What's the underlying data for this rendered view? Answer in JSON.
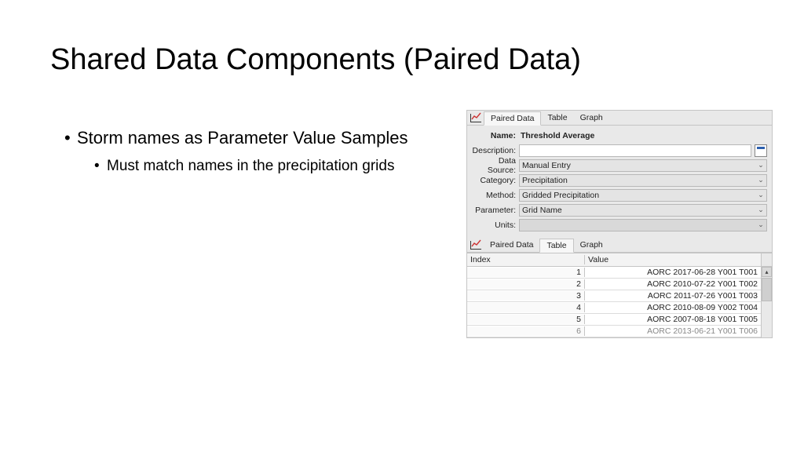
{
  "title": "Shared Data Components (Paired Data)",
  "bullets": {
    "l1": "Storm names as Parameter Value Samples",
    "l2": "Must match names in the precipitation grids"
  },
  "panel": {
    "tabs_upper": {
      "paired": "Paired Data",
      "table": "Table",
      "graph": "Graph"
    },
    "tabs_lower": {
      "paired": "Paired Data",
      "table": "Table",
      "graph": "Graph"
    },
    "labels": {
      "name": "Name:",
      "description": "Description:",
      "data_source": "Data Source:",
      "category": "Category:",
      "method": "Method:",
      "parameter": "Parameter:",
      "units": "Units:"
    },
    "values": {
      "name": "Threshold Average",
      "description": "",
      "data_source": "Manual Entry",
      "category": "Precipitation",
      "method": "Gridded Precipitation",
      "parameter": "Grid Name",
      "units": ""
    },
    "table": {
      "headers": {
        "index": "Index",
        "value": "Value"
      },
      "rows": [
        {
          "index": "1",
          "value": "AORC 2017-06-28 Y001 T001"
        },
        {
          "index": "2",
          "value": "AORC 2010-07-22 Y001 T002"
        },
        {
          "index": "3",
          "value": "AORC 2011-07-26 Y001 T003"
        },
        {
          "index": "4",
          "value": "AORC 2010-08-09 Y002 T004"
        },
        {
          "index": "5",
          "value": "AORC 2007-08-18 Y001 T005"
        },
        {
          "index": "6",
          "value": "AORC 2013-06-21 Y001 T006"
        }
      ]
    }
  }
}
